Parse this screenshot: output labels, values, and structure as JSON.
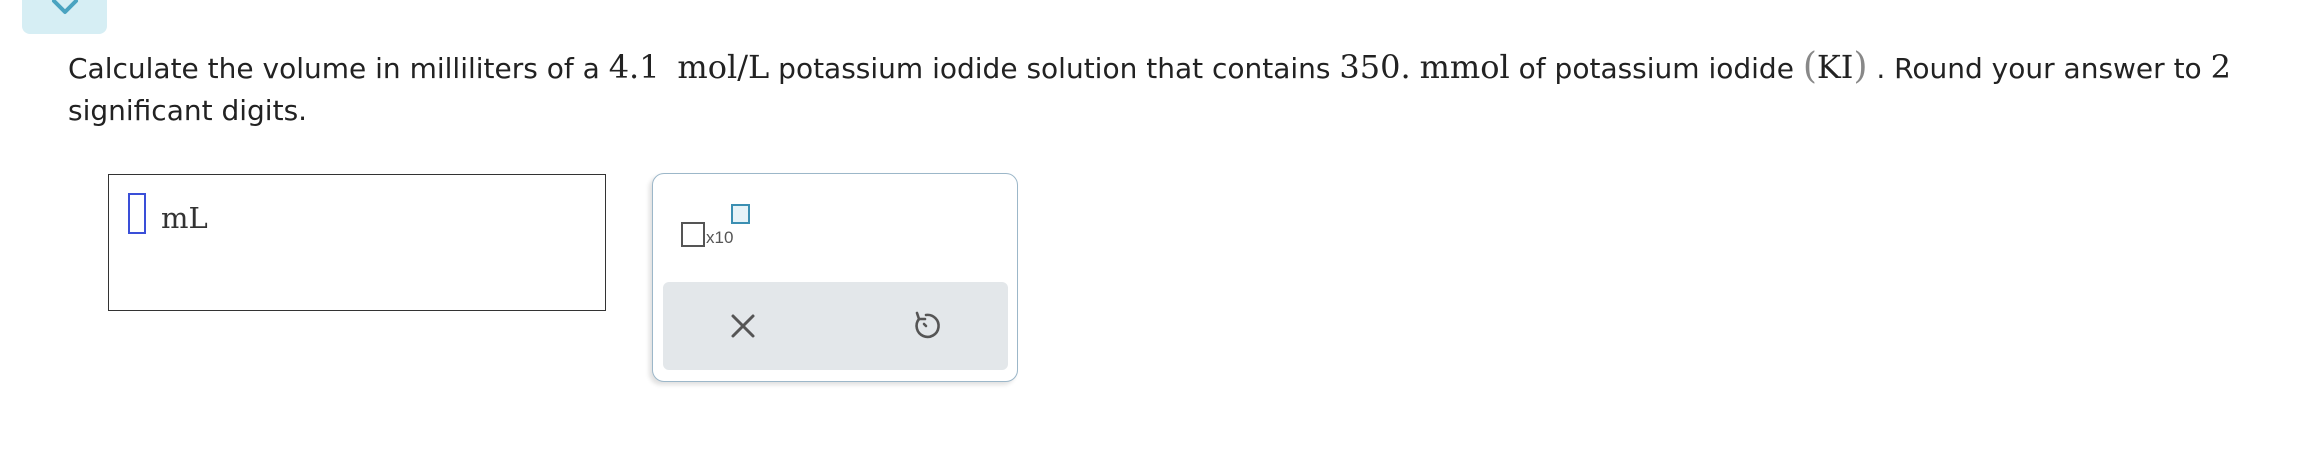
{
  "question": {
    "part1": "Calculate the volume in milliliters of a ",
    "concentration": "4.1",
    "concentration_unit": "mol/L",
    "part2": " potassium iodide solution that contains ",
    "amount": "350.",
    "amount_unit": "mmol",
    "part3": " of potassium iodide ",
    "paren_open": "(",
    "formula": "KI",
    "paren_close": ")",
    "part4": " . Round your answer to ",
    "sig_figs": "2",
    "part5": "significant digits."
  },
  "answer": {
    "value": "",
    "unit": "mL"
  },
  "toolbar": {
    "sci_notation_label": "x10",
    "clear_icon": "close-icon",
    "undo_icon": "undo-icon"
  },
  "colors": {
    "input_border": "#3a4fd8",
    "panel_border": "#9cb7c9",
    "action_bar": "#e3e7ea",
    "collapse_tab": "#d6eef4",
    "icon_accent": "#3b8fb2"
  }
}
